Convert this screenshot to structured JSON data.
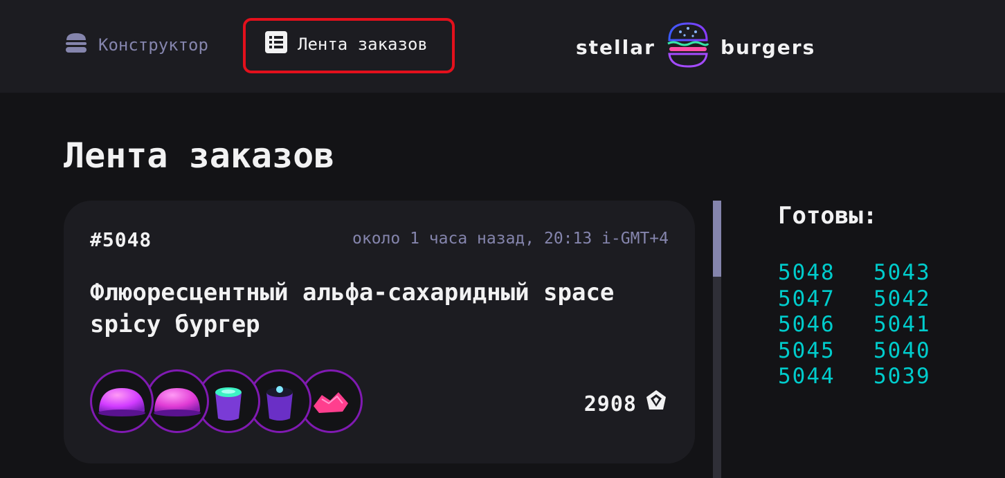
{
  "header": {
    "nav": {
      "constructor": {
        "label": "Конструктор",
        "icon": "burger-icon"
      },
      "feed": {
        "label": "Лента заказов",
        "icon": "list-icon",
        "active": true
      }
    },
    "logo": {
      "left": "stellar",
      "right": "burgers",
      "icon": "burger-neon-icon"
    }
  },
  "page": {
    "title": "Лента заказов"
  },
  "orders": [
    {
      "number": "#5048",
      "time": "около 1 часа назад, 20:13 i-GMT+4",
      "name": "Флюоресцентный альфа-сахаридный space spicy бургер",
      "price": "2908",
      "currency_icon": "currency-icon",
      "ingredients": [
        "bun-pink",
        "bun-pink",
        "sauce-cup-green",
        "sauce-cup-dark",
        "meat-pink"
      ]
    }
  ],
  "status": {
    "ready_title": "Готовы:",
    "ready_col1": [
      "5048",
      "5047",
      "5046",
      "5045",
      "5044"
    ],
    "ready_col2": [
      "5043",
      "5042",
      "5041",
      "5040",
      "5039"
    ]
  },
  "colors": {
    "background": "#131316",
    "surface": "#1C1C21",
    "accent_text_inactive": "#8585AD",
    "ready_color": "#00CCCC",
    "highlight": "#E3101C",
    "ingredient_border": "#801AB2"
  }
}
